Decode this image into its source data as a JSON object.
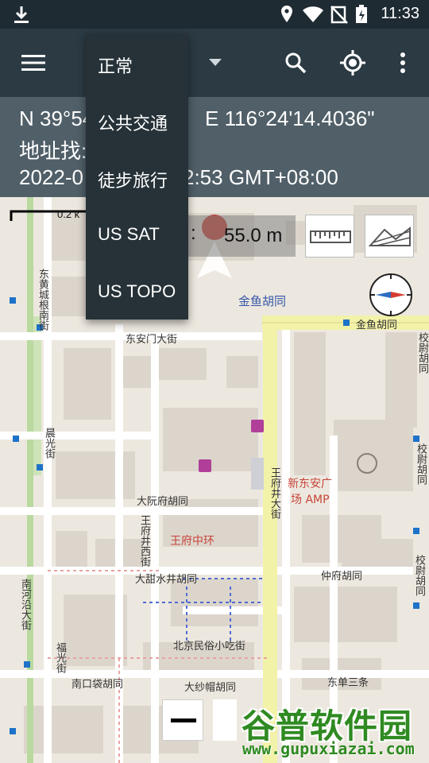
{
  "status_bar": {
    "time": "11:33"
  },
  "toolbar": {
    "selected_layer": "正常"
  },
  "info_panel": {
    "coord_north": "N 39°54",
    "coord_east": "E 116°24'14.4036\"",
    "address_label": "地址找:",
    "datetime_prefix": "2022-0",
    "datetime_suffix": "2:53 GMT+08:00"
  },
  "layer_menu": {
    "items": [
      "正常",
      "公共交通",
      "徒步旅行",
      "US SAT",
      "US TOPO"
    ]
  },
  "map": {
    "scale_label": "0.2 k",
    "elevation": "55.0 m",
    "elevation_colon": ":",
    "street_labels": {
      "dongchang": "东黄城根南街",
      "jinyu": "金鱼胡同",
      "jinyu2": "金鱼胡同",
      "donganmen": "东安门大街",
      "chenguang": "晨光街",
      "wangfujing": "王府井大街",
      "xindongan": "新东安广",
      "amp": "场 AMP",
      "dayuanfu": "大阮府胡同",
      "wangfuzhonghuan": "王府中环",
      "wangfu_xi": "王府井西街",
      "datianshui": "大甜水井胡同",
      "zhongfu": "仲府胡同",
      "nanheyan": "南河沿大街",
      "beijingminsu": "北京民俗小吃街",
      "nankou": "南口袋胡同",
      "dasha": "大纱帽胡同",
      "dongdansan": "东单三条",
      "jiaowei": "校尉胡同",
      "jiaowei2": "校尉胡同",
      "jiaowei3": "校尉胡同",
      "fuguang": "福光街",
      "dongdan_fang": "东黄城根南街",
      "xin": "新"
    },
    "colors": {
      "land": "#ede8df",
      "block": "#dcd5cc",
      "road": "#ffffff",
      "major_road": "#f2f2a8",
      "park": "#b9d9a0",
      "poi": "#b03f9a"
    }
  },
  "watermark": {
    "title": "谷普软件园",
    "url": "www.gupuxiazai.com"
  }
}
